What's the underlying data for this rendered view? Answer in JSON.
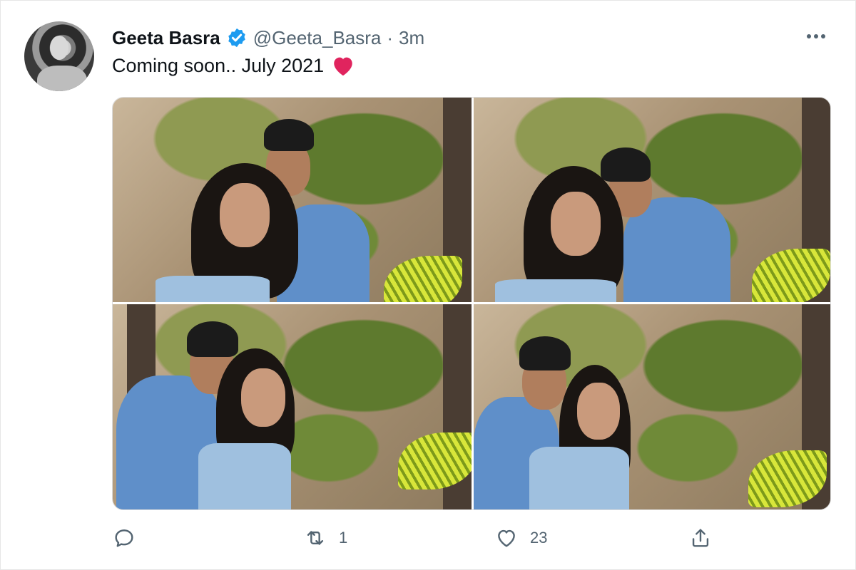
{
  "tweet": {
    "author_name": "Geeta Basra",
    "handle": "@Geeta_Basra",
    "separator": "·",
    "time": "3m",
    "text": "Coming soon.. July 2021",
    "text_emoji": "red-heart",
    "verified": true,
    "accent": "#1d9bf0",
    "heart_color": "#e0245e"
  },
  "media": {
    "count": 4,
    "layout": "2x2 grid"
  },
  "actions": {
    "reply_count": "",
    "retweet_count": "1",
    "like_count": "23",
    "share_count": ""
  },
  "icons": [
    "reply-icon",
    "retweet-icon",
    "like-icon",
    "share-icon",
    "more-icon",
    "verified-icon"
  ]
}
